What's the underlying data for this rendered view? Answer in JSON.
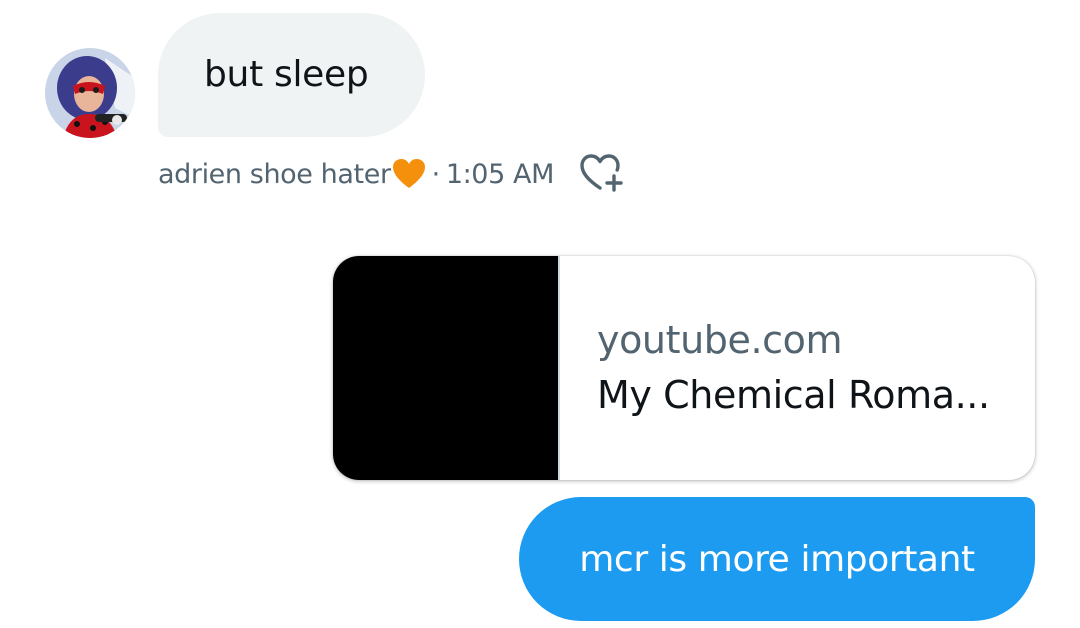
{
  "conversation": {
    "incoming": {
      "avatar_description": "avatar",
      "message": "but sleep",
      "sender": "adrien shoe hater",
      "sender_emoji": "orange-heart-emoji",
      "separator": "·",
      "timestamp": "1:05 AM",
      "react_icon": "heart-plus-icon"
    },
    "link_preview": {
      "domain": "youtube.com",
      "title": "My Chemical Roma..."
    },
    "outgoing": {
      "message": "mcr is more important"
    }
  },
  "colors": {
    "incoming_bubble": "#eff3f4",
    "outgoing_bubble": "#1d9bf0",
    "meta_text": "#536471",
    "primary_text": "#0f1419",
    "heart_emoji": "#f4900c"
  }
}
